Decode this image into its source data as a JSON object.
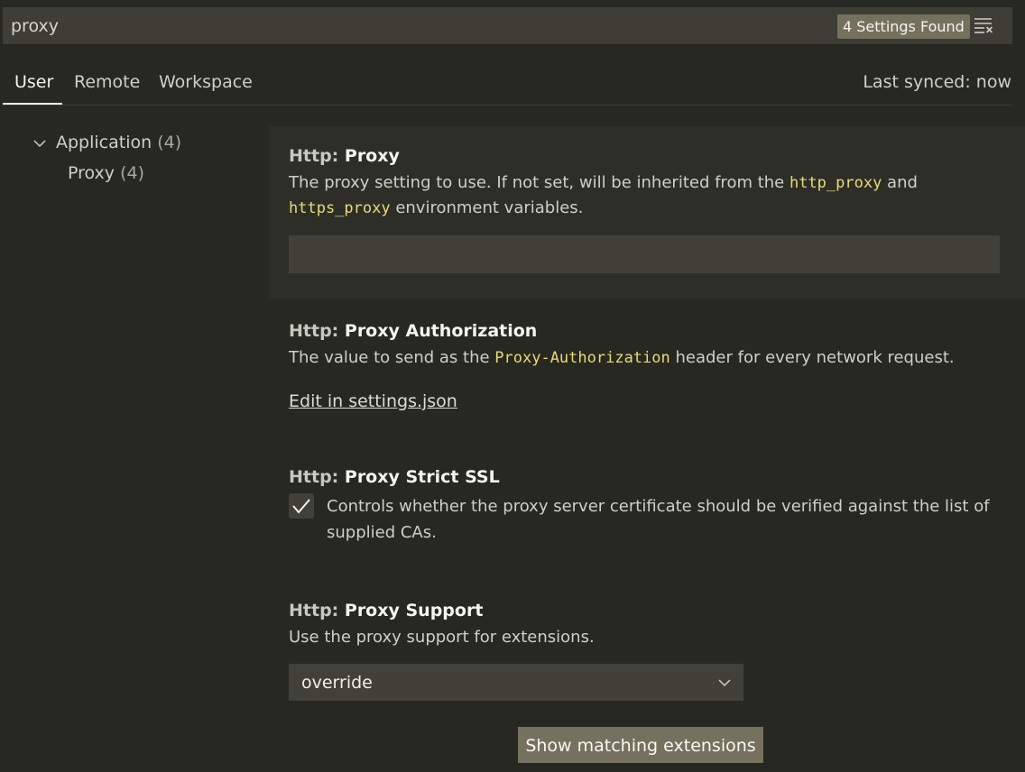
{
  "search": {
    "value": "proxy",
    "results_badge": "4 Settings Found"
  },
  "tabs": [
    {
      "label": "User"
    },
    {
      "label": "Remote"
    },
    {
      "label": "Workspace"
    }
  ],
  "sync_status": "Last synced: now",
  "tree": {
    "group": {
      "label": "Application",
      "count": "(4)"
    },
    "child": {
      "label": "Proxy",
      "count": "(4)"
    }
  },
  "settings": {
    "proxy": {
      "category": "Http: ",
      "name": "Proxy",
      "desc_1": "The proxy setting to use. If not set, will be inherited from the ",
      "code_1": "http_proxy",
      "desc_2": " and ",
      "code_2": "https_proxy",
      "desc_3": " environment variables.",
      "value": ""
    },
    "authorization": {
      "category": "Http: ",
      "name": "Proxy Authorization",
      "desc_1": "The value to send as the ",
      "code_1": "Proxy-Authorization",
      "desc_2": " header for every network request.",
      "link": "Edit in settings.json"
    },
    "strict_ssl": {
      "category": "Http: ",
      "name": "Proxy Strict SSL",
      "checked": true,
      "description": "Controls whether the proxy server certificate should be verified against the list of supplied CAs."
    },
    "support": {
      "category": "Http: ",
      "name": "Proxy Support",
      "description": "Use the proxy support for extensions.",
      "selected": "override"
    }
  },
  "extensions_button": "Show matching extensions",
  "colors": {
    "background": "#272822",
    "accent_badge": "#75715e",
    "code": "#e6db74"
  }
}
